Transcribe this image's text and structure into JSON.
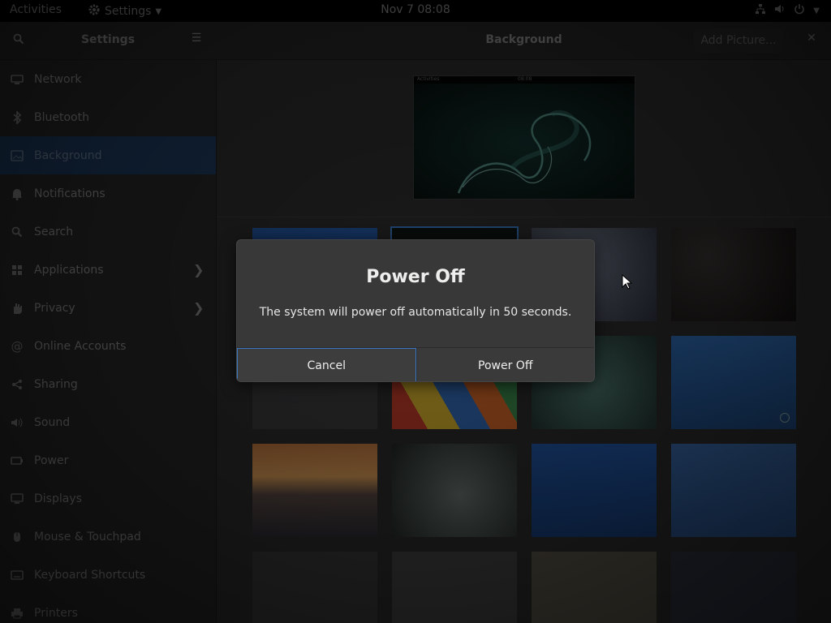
{
  "topbar": {
    "activities": "Activities",
    "app_menu": "Settings",
    "clock": "Nov 7  08:08"
  },
  "header": {
    "sidebar_title": "Settings",
    "title": "Background",
    "add_picture": "Add Picture..."
  },
  "sidebar": {
    "items": [
      {
        "label": "Network",
        "icon": "network-icon"
      },
      {
        "label": "Bluetooth",
        "icon": "bluetooth-icon"
      },
      {
        "label": "Background",
        "icon": "background-icon",
        "selected": true
      },
      {
        "label": "Notifications",
        "icon": "bell-icon"
      },
      {
        "label": "Search",
        "icon": "search-icon"
      },
      {
        "label": "Applications",
        "icon": "apps-grid-icon",
        "chevron": true
      },
      {
        "label": "Privacy",
        "icon": "hand-icon",
        "chevron": true
      },
      {
        "label": "Online Accounts",
        "icon": "at-icon"
      },
      {
        "label": "Sharing",
        "icon": "share-icon"
      },
      {
        "label": "Sound",
        "icon": "speaker-icon"
      },
      {
        "label": "Power",
        "icon": "battery-icon"
      },
      {
        "label": "Displays",
        "icon": "monitor-icon"
      },
      {
        "label": "Mouse & Touchpad",
        "icon": "mouse-icon"
      },
      {
        "label": "Keyboard Shortcuts",
        "icon": "keyboard-icon"
      },
      {
        "label": "Printers",
        "icon": "printer-icon"
      }
    ]
  },
  "preview": {
    "bar_left": "Activities",
    "bar_center": "08:08"
  },
  "dialog": {
    "title": "Power Off",
    "message": "The system will power off automatically in 50 seconds.",
    "cancel": "Cancel",
    "confirm": "Power Off"
  },
  "colors": {
    "accent": "#3b78c4",
    "selected_row": "#1d3a5e",
    "dialog_bg": "#383838"
  }
}
